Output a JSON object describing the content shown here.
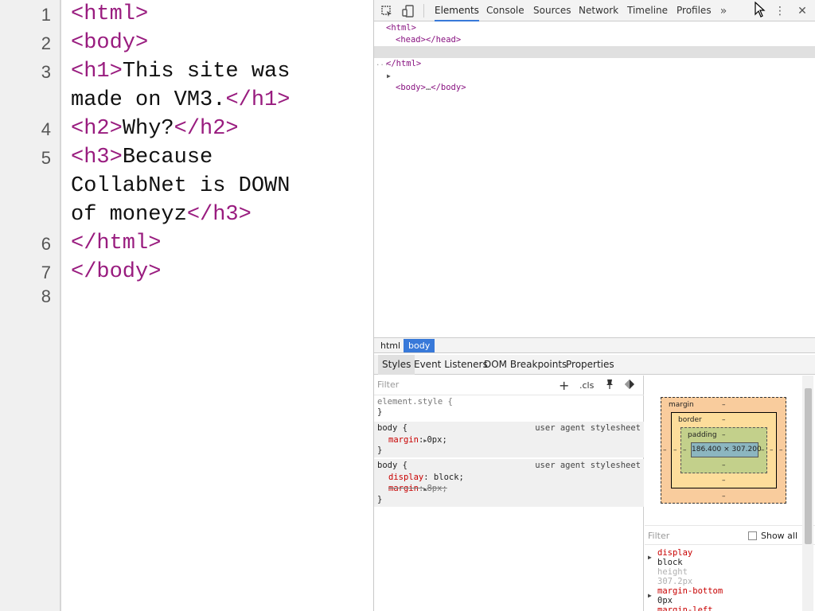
{
  "editor": {
    "line_numbers": [
      "1",
      "2",
      "3",
      "4",
      "5",
      "6",
      "7",
      "8"
    ],
    "lines": [
      {
        "parts": [
          {
            "text": "<html>",
            "kind": "tag"
          }
        ]
      },
      {
        "parts": [
          {
            "text": "<body>",
            "kind": "tag"
          }
        ]
      },
      {
        "parts": [
          {
            "text": "<h1>",
            "kind": "tag"
          },
          {
            "text": "This site was",
            "kind": "text"
          }
        ]
      },
      {
        "parts": [
          {
            "text": "made on VM3.",
            "kind": "text"
          },
          {
            "text": "</h1>",
            "kind": "tag"
          }
        ]
      },
      {
        "parts": [
          {
            "text": "<h2>",
            "kind": "tag"
          },
          {
            "text": "Why?",
            "kind": "text"
          },
          {
            "text": "</h2>",
            "kind": "tag"
          }
        ]
      },
      {
        "parts": [
          {
            "text": "<h3>",
            "kind": "tag"
          },
          {
            "text": "Because",
            "kind": "text"
          }
        ]
      },
      {
        "parts": [
          {
            "text": "CollabNet is DOWN",
            "kind": "text"
          }
        ]
      },
      {
        "parts": [
          {
            "text": "of moneyz",
            "kind": "text"
          },
          {
            "text": "</h3>",
            "kind": "tag"
          }
        ]
      },
      {
        "parts": [
          {
            "text": "</html>",
            "kind": "tag"
          }
        ]
      },
      {
        "parts": [
          {
            "text": "</body>",
            "kind": "tag"
          }
        ]
      }
    ]
  },
  "devtools": {
    "tabs": [
      "Elements",
      "Console",
      "Sources",
      "Network",
      "Timeline",
      "Profiles"
    ],
    "active_tab": "Elements",
    "more_tabs_icon": "»",
    "menu_icon": "⋮",
    "close_icon": "✕",
    "dom_tree": [
      {
        "open": "<html>",
        "middle": "",
        "close": ""
      },
      {
        "open": "<head>",
        "middle": "",
        "close": "</head>"
      },
      {
        "open": "<body>",
        "middle": "…",
        "close": "</body>",
        "selected": true,
        "expand_arrow": "▶",
        "marker": "..."
      },
      {
        "open": "</html>",
        "middle": "",
        "close": ""
      }
    ],
    "breadcrumbs": [
      "html",
      "body"
    ],
    "active_crumb": "body",
    "subtabs": [
      "Styles",
      "Event Listeners",
      "DOM Breakpoints",
      "Properties"
    ],
    "active_subtab": "Styles",
    "styles_filter_placeholder": "Filter",
    "styles_toolbar": {
      "add": "+",
      "cls": ".cls"
    },
    "style_rules": [
      {
        "selector": "element.style {",
        "close": "}",
        "source": "",
        "props": []
      },
      {
        "selector": "body {",
        "close": "}",
        "source": "user agent stylesheet",
        "props": [
          {
            "name": "margin",
            "value": "0px;",
            "arrow": "▶",
            "struck": false
          }
        ]
      },
      {
        "selector": "body {",
        "close": "}",
        "source": "user agent stylesheet",
        "props": [
          {
            "name": "display",
            "value": "block;",
            "arrow": "",
            "struck": false
          },
          {
            "name": "margin",
            "value": "8px;",
            "arrow": "▶",
            "struck": true
          }
        ]
      }
    ],
    "box_model": {
      "margin_label": "margin",
      "border_label": "border",
      "padding_label": "padding",
      "dash": "–",
      "content_size": "186.400 × 307.200"
    },
    "computed_filter_placeholder": "Filter",
    "show_all_label": "Show all",
    "computed": [
      {
        "name": "display",
        "value": "block",
        "inherited": false,
        "arrow": "▶"
      },
      {
        "name": "height",
        "value": "307.2px",
        "inherited": true,
        "arrow": ""
      },
      {
        "name": "margin-bottom",
        "value": "0px",
        "inherited": false,
        "arrow": "▶"
      },
      {
        "name": "margin-left",
        "value": "",
        "inherited": false,
        "arrow": ""
      }
    ],
    "colors": {
      "accent": "#3879d9",
      "tag": "#881280",
      "prop": "#c80000"
    }
  }
}
